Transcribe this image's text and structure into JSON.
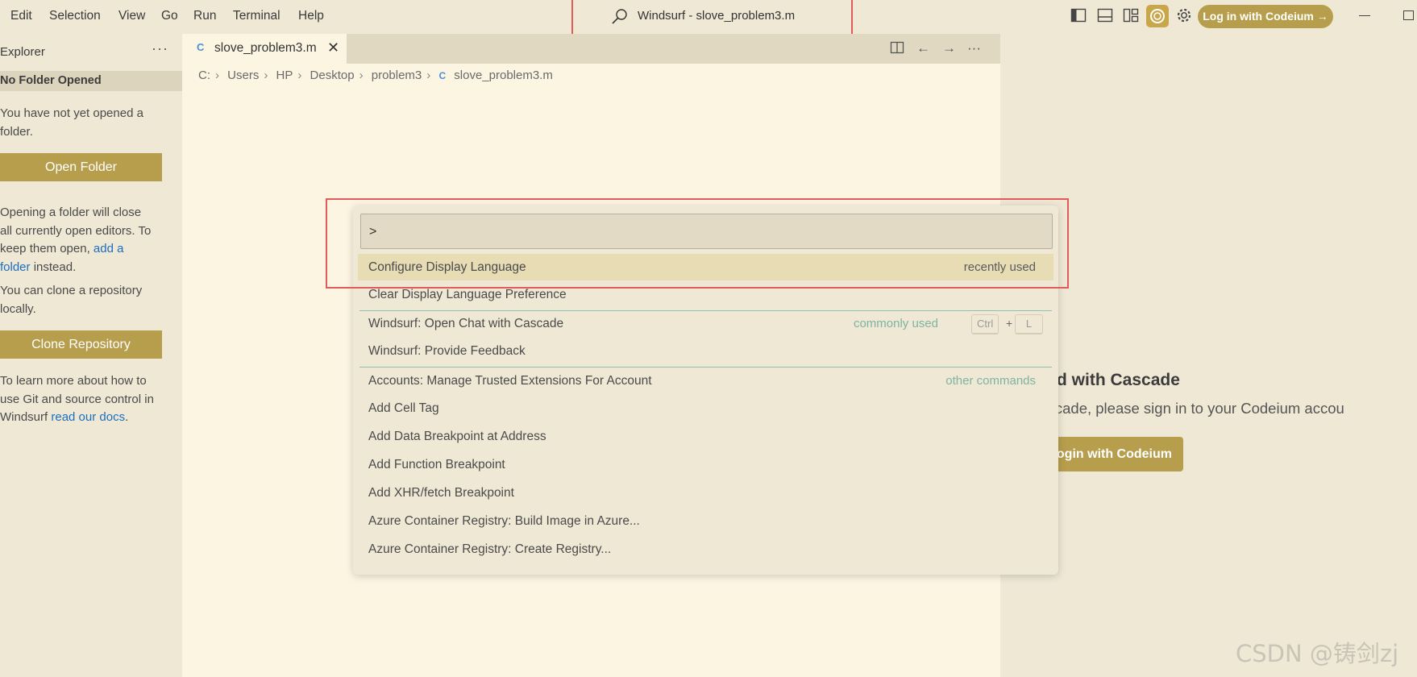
{
  "menu": [
    "Edit",
    "Selection",
    "View",
    "Go",
    "Run",
    "Terminal",
    "Help"
  ],
  "window": {
    "title": "Windsurf - slove_problem3.m",
    "login_button": "Log in with Codeium →"
  },
  "sidebar": {
    "title": "Explorer",
    "more": "···",
    "section_header": "No Folder Opened",
    "text1_line1": "You have not yet opened a",
    "text1_line2": "folder.",
    "open_folder_button": "Open Folder",
    "text2_line1": "Opening a folder will close",
    "text2_line2": "all currently open editors. To",
    "text2_line3_pre": "keep them open, ",
    "text2_line3_link": "add a",
    "text2_line4_link": "folder",
    "text2_line4_post": " instead.",
    "text3_line1": "You can clone a repository",
    "text3_line2": "locally.",
    "clone_button": "Clone Repository",
    "text4_line1": "To learn more about how to",
    "text4_line2": "use Git and source control in",
    "text4_line3_pre": "Windsurf ",
    "text4_line3_link": "read our docs",
    "text4_line3_post": "."
  },
  "editor": {
    "tab_label": "slove_problem3.m",
    "tab_icon": "C",
    "breadcrumb": [
      "C:",
      "Users",
      "HP",
      "Desktop",
      "problem3",
      "slove_problem3.m"
    ]
  },
  "palette": {
    "input_value": ">",
    "commands": [
      {
        "label": "Configure Display Language",
        "tag": "recently used"
      },
      {
        "label": "Clear Display Language Preference",
        "tag": ""
      },
      {
        "label": "Windsurf: Open Chat with Cascade",
        "tag": "commonly used",
        "keys": [
          "Ctrl",
          "L"
        ]
      },
      {
        "label": "Windsurf: Provide Feedback",
        "tag": ""
      },
      {
        "label": "Accounts: Manage Trusted Extensions For Account",
        "tag": "other commands"
      },
      {
        "label": "Add Cell Tag",
        "tag": ""
      },
      {
        "label": "Add Data Breakpoint at Address",
        "tag": ""
      },
      {
        "label": "Add Function Breakpoint",
        "tag": ""
      },
      {
        "label": "Add XHR/fetch Breakpoint",
        "tag": ""
      },
      {
        "label": "Azure Container Registry: Build Image in Azure...",
        "tag": ""
      },
      {
        "label": "Azure Container Registry: Create Registry...",
        "tag": ""
      }
    ],
    "key_plus": "+"
  },
  "cascade": {
    "title": "t started with Cascade",
    "subtitle": "use Cascade, please sign in to your Codeium accou",
    "login_button": "ogin with Codeium"
  },
  "watermark": "CSDN @铸剑zj",
  "colors": {
    "accent": "#b79e4d",
    "highlight_box": "#e25a5a",
    "editor_bg": "#fcf5e2",
    "chrome_bg": "#efe8d5",
    "link": "#1a6fc2"
  }
}
